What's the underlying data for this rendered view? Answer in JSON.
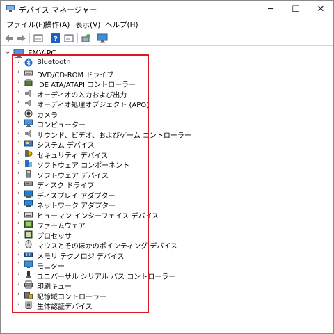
{
  "window": {
    "title": "デバイス マネージャー",
    "controls": {
      "minimize": "─",
      "maximize": "☐",
      "close": "✕"
    }
  },
  "menubar": {
    "items": [
      "ファイル(F)",
      "操作(A)",
      "表示(V)",
      "ヘルプ(H)"
    ]
  },
  "toolbar": {
    "buttons": [
      "back-icon",
      "forward-icon",
      "properties-icon",
      "help-icon",
      "window-icon",
      "scan-hardware-icon",
      "monitor-icon"
    ]
  },
  "tree": {
    "root": {
      "label": "FMV-PC",
      "icon": "computer-icon",
      "expanded": true
    },
    "items": [
      {
        "label": "Bluetooth",
        "icon": "bluetooth-icon"
      },
      {
        "label": "DVD/CD-ROM ドライブ",
        "icon": "dvd-drive-icon"
      },
      {
        "label": "IDE ATA/ATAPI コントローラー",
        "icon": "ide-controller-icon"
      },
      {
        "label": "オーディオの入力および出力",
        "icon": "speaker-icon"
      },
      {
        "label": "オーディオ処理オブジェクト (APO)",
        "icon": "speaker-icon"
      },
      {
        "label": "カメラ",
        "icon": "camera-icon"
      },
      {
        "label": "コンピューター",
        "icon": "computer-icon"
      },
      {
        "label": "サウンド、ビデオ、およびゲーム コントローラー",
        "icon": "speaker-icon"
      },
      {
        "label": "システム デバイス",
        "icon": "system-device-icon"
      },
      {
        "label": "セキュリティ デバイス",
        "icon": "security-device-icon"
      },
      {
        "label": "ソフトウェア コンポーネント",
        "icon": "software-component-icon"
      },
      {
        "label": "ソフトウェア デバイス",
        "icon": "software-device-icon"
      },
      {
        "label": "ディスク ドライブ",
        "icon": "disk-drive-icon"
      },
      {
        "label": "ディスプレイ アダプター",
        "icon": "display-adapter-icon"
      },
      {
        "label": "ネットワーク アダプター",
        "icon": "network-adapter-icon"
      },
      {
        "label": "ヒューマン インターフェイス デバイス",
        "icon": "hid-icon"
      },
      {
        "label": "ファームウェア",
        "icon": "firmware-icon"
      },
      {
        "label": "プロセッサ",
        "icon": "processor-icon"
      },
      {
        "label": "マウスとそのほかのポインティング デバイス",
        "icon": "mouse-icon"
      },
      {
        "label": "メモリ テクノロジ デバイス",
        "icon": "memory-icon"
      },
      {
        "label": "モニター",
        "icon": "monitor-icon"
      },
      {
        "label": "ユニバーサル シリアル バス コントローラー",
        "icon": "usb-icon"
      },
      {
        "label": "印刷キュー",
        "icon": "printer-icon"
      },
      {
        "label": "記憶域コントローラー",
        "icon": "storage-controller-icon"
      },
      {
        "label": "生体認証デバイス",
        "icon": "biometric-icon"
      }
    ]
  },
  "colors": {
    "highlight_border": "#d9182a",
    "accent_blue": "#2b7cd3"
  }
}
